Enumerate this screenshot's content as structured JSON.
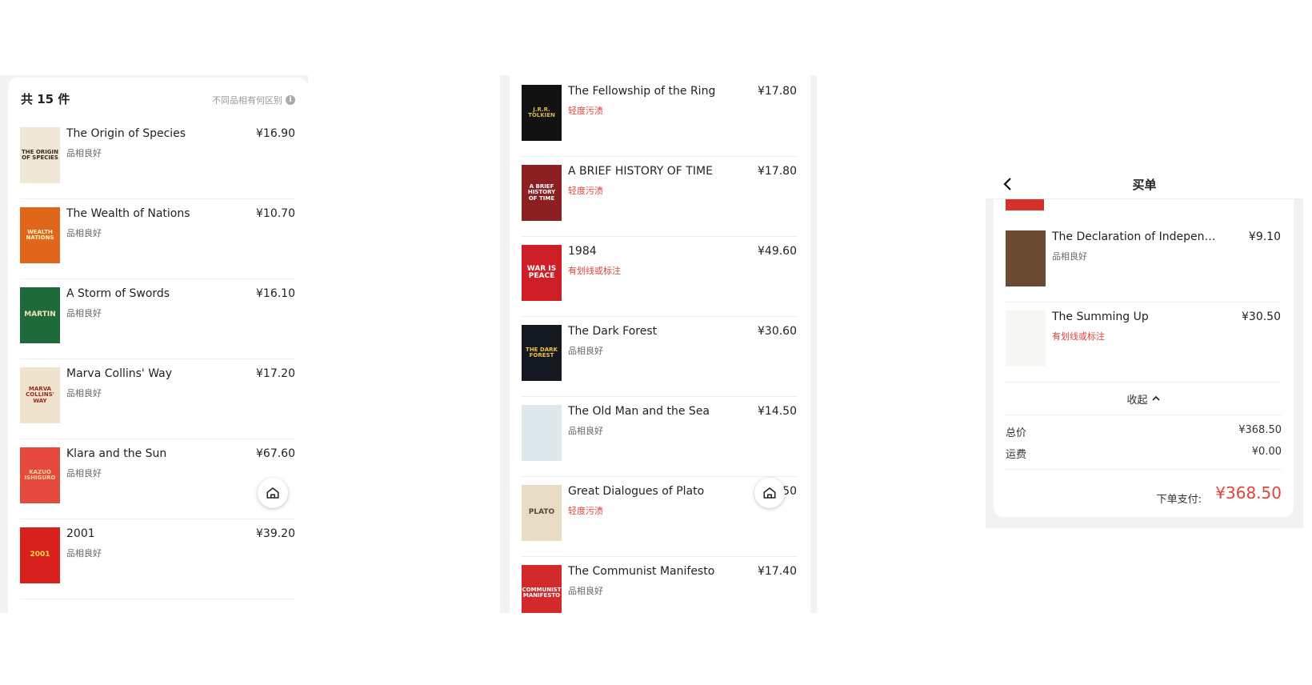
{
  "panel1": {
    "count_label": "共 15 件",
    "grade_link": "不同品相有何区别",
    "info_icon": "info-icon",
    "items": [
      {
        "title": "The Origin of Species",
        "price": "¥16.90",
        "condition": "品相良好",
        "condition_type": "good",
        "cover_text": "THE ORIGIN OF SPECIES",
        "cover_bg": "#efe6d6",
        "cover_fg": "#3a2c1e"
      },
      {
        "title": "The Wealth of Nations",
        "price": "¥10.70",
        "condition": "品相良好",
        "condition_type": "good",
        "cover_text": "WEALTH NATIONS",
        "cover_bg": "#e0661c",
        "cover_fg": "#fff3c0"
      },
      {
        "title": "A Storm of Swords",
        "price": "¥16.10",
        "condition": "品相良好",
        "condition_type": "good",
        "cover_text": "MARTIN",
        "cover_bg": "#1f6a3a",
        "cover_fg": "#f2e6b8"
      },
      {
        "title": "Marva Collins' Way",
        "price": "¥17.20",
        "condition": "品相良好",
        "condition_type": "good",
        "cover_text": "MARVA COLLINS' WAY",
        "cover_bg": "#efe3cd",
        "cover_fg": "#9c2a1a"
      },
      {
        "title": "Klara and the Sun",
        "price": "¥67.60",
        "condition": "品相良好",
        "condition_type": "good",
        "cover_text": "KAZUO ISHIGURO",
        "cover_bg": "#e6493d",
        "cover_fg": "#f8d8a0"
      },
      {
        "title": "2001",
        "price": "¥39.20",
        "condition": "品相良好",
        "condition_type": "good",
        "cover_text": "2001",
        "cover_bg": "#d8201e",
        "cover_fg": "#ffdf3a"
      }
    ]
  },
  "panel2": {
    "items": [
      {
        "title": "The Fellowship of the Ring",
        "price": "¥17.80",
        "condition": "轻度污渍",
        "condition_type": "bad",
        "cover_text": "J.R.R. TOLKIEN",
        "cover_bg": "#111111",
        "cover_fg": "#d9b84a"
      },
      {
        "title": "A BRIEF HISTORY OF TIME",
        "price": "¥17.80",
        "condition": "轻度污渍",
        "condition_type": "bad",
        "cover_text": "A BRIEF HISTORY OF TIME",
        "cover_bg": "#8c1f22",
        "cover_fg": "#ffffff"
      },
      {
        "title": "1984",
        "price": "¥49.60",
        "condition": "有划线或标注",
        "condition_type": "bad",
        "cover_text": "WAR IS PEACE",
        "cover_bg": "#cf1f26",
        "cover_fg": "#ffffff"
      },
      {
        "title": "The Dark Forest",
        "price": "¥30.60",
        "condition": "品相良好",
        "condition_type": "good",
        "cover_text": "THE DARK FOREST",
        "cover_bg": "#141820",
        "cover_fg": "#f3c23c"
      },
      {
        "title": "The Old Man and the Sea",
        "price": "¥14.50",
        "condition": "品相良好",
        "condition_type": "good",
        "cover_text": "",
        "cover_bg": "#dfe8ea",
        "cover_fg": "#2b5673"
      },
      {
        "title": "Great Dialogues of Plato",
        "price": "¥13.50",
        "condition": "轻度污渍",
        "condition_type": "bad",
        "cover_text": "PLATO",
        "cover_bg": "#e8dcc4",
        "cover_fg": "#5a4630"
      },
      {
        "title": "The Communist Manifesto",
        "price": "¥17.40",
        "condition": "品相良好",
        "condition_type": "good",
        "cover_text": "COMMUNIST MANIFESTO",
        "cover_bg": "#d22a2a",
        "cover_fg": "#ffffff"
      }
    ]
  },
  "panel3": {
    "page_title": "买单",
    "back_icon": "chevron-left-icon",
    "items": [
      {
        "title": "The Declaration of Independence...",
        "price": "¥9.10",
        "condition": "品相良好",
        "condition_type": "good",
        "cover_text": "",
        "cover_bg": "#6a4a32",
        "cover_fg": "#f0d9a8"
      },
      {
        "title": "The Summing Up",
        "price": "¥30.50",
        "condition": "有划线或标注",
        "condition_type": "bad",
        "cover_text": "",
        "cover_bg": "#f6f6f2",
        "cover_fg": "#1a1a1a"
      }
    ],
    "collapse_label": "收起",
    "collapse_icon": "chevron-up-icon",
    "total_label": "总价",
    "total_value": "¥368.50",
    "shipping_label": "运费",
    "shipping_value": "¥0.00",
    "pay_label": "下单支付:",
    "pay_amount": "¥368.50"
  },
  "home_icon": "home-icon",
  "colors": {
    "accent_red": "#e0443a",
    "panel_bg": "#f2f2f2",
    "card_bg": "#ffffff"
  }
}
